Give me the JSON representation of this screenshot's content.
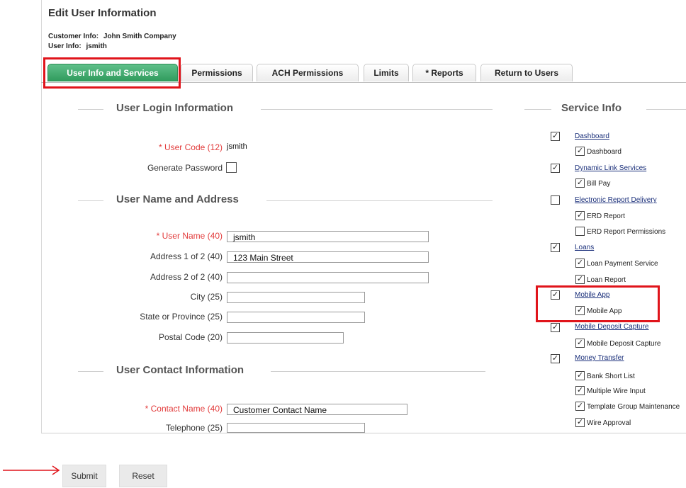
{
  "page": {
    "title": "Edit User Information",
    "customer_label": "Customer Info:",
    "customer_value": "John Smith Company",
    "user_label": "User Info:",
    "user_value": "jsmith"
  },
  "tabs": [
    {
      "label": "User Info and Services",
      "active": true
    },
    {
      "label": "Permissions",
      "active": false
    },
    {
      "label": "ACH Permissions",
      "active": false
    },
    {
      "label": "Limits",
      "active": false
    },
    {
      "label": "* Reports",
      "active": false
    },
    {
      "label": "Return to Users",
      "active": false
    }
  ],
  "login": {
    "heading": "User Login Information",
    "user_code_label": "* User Code (12)",
    "user_code_value": "jsmith",
    "generate_password_label": "Generate Password"
  },
  "name_address": {
    "heading": "User Name and Address",
    "fields": [
      {
        "label": "* User Name (40)",
        "value": "jsmith"
      },
      {
        "label": "Address 1 of 2 (40)",
        "value": "123 Main Street"
      },
      {
        "label": "Address 2 of 2 (40)",
        "value": ""
      },
      {
        "label": "City (25)",
        "value": ""
      },
      {
        "label": "State or Province (25)",
        "value": ""
      },
      {
        "label": "Postal Code (20)",
        "value": ""
      }
    ]
  },
  "contact": {
    "heading": "User Contact Information",
    "fields": [
      {
        "label": "* Contact Name (40)",
        "value": "Customer Contact Name"
      },
      {
        "label": "Telephone (25)",
        "value": ""
      }
    ]
  },
  "service": {
    "heading": "Service Info",
    "items": [
      {
        "label": "Dashboard",
        "level": "top",
        "checked": true
      },
      {
        "label": "Dashboard",
        "level": "sub",
        "checked": true
      },
      {
        "label": "Dynamic Link Services",
        "level": "top",
        "checked": true
      },
      {
        "label": "Bill Pay",
        "level": "sub",
        "checked": true
      },
      {
        "label": "Electronic Report Delivery",
        "level": "top",
        "checked": false
      },
      {
        "label": "ERD Report",
        "level": "sub",
        "checked": true
      },
      {
        "label": "ERD Report Permissions",
        "level": "sub",
        "checked": false
      },
      {
        "label": "Loans",
        "level": "top",
        "checked": true
      },
      {
        "label": "Loan Payment Service",
        "level": "sub",
        "checked": true
      },
      {
        "label": "Loan Report",
        "level": "sub",
        "checked": true
      },
      {
        "label": "Mobile App",
        "level": "top",
        "checked": true
      },
      {
        "label": "Mobile App",
        "level": "sub",
        "checked": true
      },
      {
        "label": "Mobile Deposit Capture",
        "level": "top",
        "checked": true
      },
      {
        "label": "Mobile Deposit Capture",
        "level": "sub",
        "checked": true
      },
      {
        "label": "Money Transfer",
        "level": "top",
        "checked": true
      },
      {
        "label": "Bank Short List",
        "level": "sub",
        "checked": true
      },
      {
        "label": "Multiple Wire Input",
        "level": "sub",
        "checked": true
      },
      {
        "label": "Template Group Maintenance",
        "level": "sub",
        "checked": true
      },
      {
        "label": "Wire Approval",
        "level": "sub",
        "checked": true
      }
    ]
  },
  "buttons": {
    "submit": "Submit",
    "reset": "Reset"
  },
  "glyphs": {
    "check": "✓"
  },
  "colors": {
    "accent": "#2f9a5c",
    "annotation": "#e0141b",
    "required": "#e23b3b",
    "link": "#1a2f7a"
  }
}
